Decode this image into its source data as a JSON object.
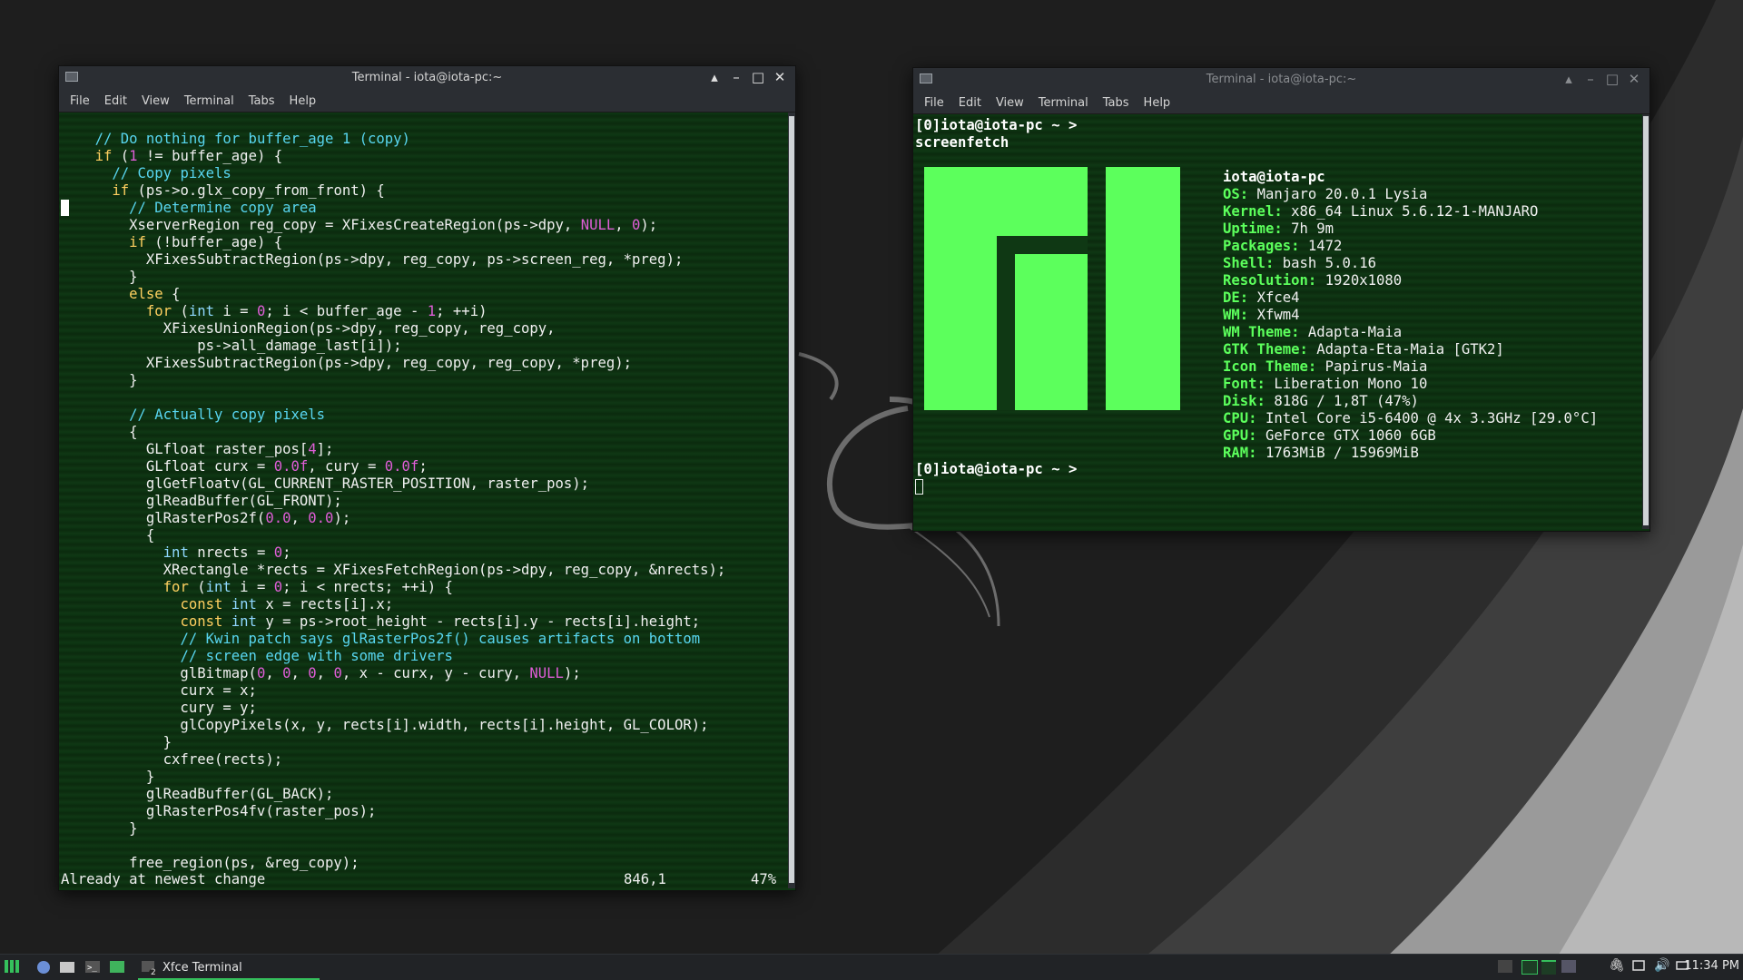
{
  "colors": {
    "accent": "#5cff5c",
    "terminal_bg": "#0f3814",
    "titlebar": "#2b2e33",
    "taskbar": "#212326"
  },
  "left_terminal": {
    "title": "Terminal - iota@iota-pc:~",
    "menu": [
      "File",
      "Edit",
      "View",
      "Terminal",
      "Tabs",
      "Help"
    ],
    "code_lines": [
      "    // Do nothing for buffer_age 1 (copy)",
      "    if (1 != buffer_age) {",
      "      // Copy pixels",
      "      if (ps->o.glx_copy_from_front) {",
      "        // Determine copy area",
      "        XserverRegion reg_copy = XFixesCreateRegion(ps->dpy, NULL, 0);",
      "        if (!buffer_age) {",
      "          XFixesSubtractRegion(ps->dpy, reg_copy, ps->screen_reg, *preg);",
      "        }",
      "        else {",
      "          for (int i = 0; i < buffer_age - 1; ++i)",
      "            XFixesUnionRegion(ps->dpy, reg_copy, reg_copy,",
      "                ps->all_damage_last[i]);",
      "          XFixesSubtractRegion(ps->dpy, reg_copy, reg_copy, *preg);",
      "        }",
      "",
      "        // Actually copy pixels",
      "        {",
      "          GLfloat raster_pos[4];",
      "          GLfloat curx = 0.0f, cury = 0.0f;",
      "          glGetFloatv(GL_CURRENT_RASTER_POSITION, raster_pos);",
      "          glReadBuffer(GL_FRONT);",
      "          glRasterPos2f(0.0, 0.0);",
      "          {",
      "            int nrects = 0;",
      "            XRectangle *rects = XFixesFetchRegion(ps->dpy, reg_copy, &nrects);",
      "            for (int i = 0; i < nrects; ++i) {",
      "              const int x = rects[i].x;",
      "              const int y = ps->root_height - rects[i].y - rects[i].height;",
      "              // Kwin patch says glRasterPos2f() causes artifacts on bottom",
      "              // screen edge with some drivers",
      "              glBitmap(0, 0, 0, 0, x - curx, y - cury, NULL);",
      "              curx = x;",
      "              cury = y;",
      "              glCopyPixels(x, y, rects[i].width, rects[i].height, GL_COLOR);",
      "            }",
      "            cxfree(rects);",
      "          }",
      "          glReadBuffer(GL_BACK);",
      "          glRasterPos4fv(raster_pos);",
      "        }",
      "",
      "        free_region(ps, &reg_copy);"
    ],
    "status_message": "Already at newest change",
    "status_position": "846,1",
    "status_percent": "47%"
  },
  "right_terminal": {
    "title": "Terminal - iota@iota-pc:~",
    "menu": [
      "File",
      "Edit",
      "View",
      "Terminal",
      "Tabs",
      "Help"
    ],
    "prompt": "[0]iota@iota-pc ~ >",
    "command": "screenfetch",
    "user_host": "iota@iota-pc",
    "info": [
      {
        "key": "OS:",
        "value": "Manjaro 20.0.1 Lysia"
      },
      {
        "key": "Kernel:",
        "value": "x86_64 Linux 5.6.12-1-MANJARO"
      },
      {
        "key": "Uptime:",
        "value": "7h 9m"
      },
      {
        "key": "Packages:",
        "value": "1472"
      },
      {
        "key": "Shell:",
        "value": "bash 5.0.16"
      },
      {
        "key": "Resolution:",
        "value": "1920x1080"
      },
      {
        "key": "DE:",
        "value": "Xfce4"
      },
      {
        "key": "WM:",
        "value": "Xfwm4"
      },
      {
        "key": "WM Theme:",
        "value": "Adapta-Maia"
      },
      {
        "key": "GTK Theme:",
        "value": "Adapta-Eta-Maia [GTK2]"
      },
      {
        "key": "Icon Theme:",
        "value": "Papirus-Maia"
      },
      {
        "key": "Font:",
        "value": "Liberation Mono 10"
      },
      {
        "key": "Disk:",
        "value": "818G / 1,8T (47%)"
      },
      {
        "key": "CPU:",
        "value": "Intel Core i5-6400 @ 4x 3.3GHz [29.0°C]"
      },
      {
        "key": "GPU:",
        "value": "GeForce GTX 1060 6GB"
      },
      {
        "key": "RAM:",
        "value": "1763MiB / 15969MiB"
      }
    ],
    "prompt2": "[0]iota@iota-pc ~ >"
  },
  "taskbar": {
    "app_label": "Xfce Terminal",
    "badge": "2",
    "clock": "11:34 PM"
  }
}
